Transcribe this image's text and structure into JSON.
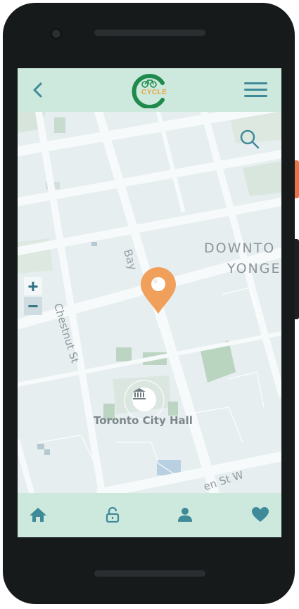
{
  "colors": {
    "accent": "#3f8a98",
    "header_bg": "#cde9dd",
    "pin": "#f0a05a",
    "logo_ring": "#1f8a4c",
    "logo_text": "#e8a53a"
  },
  "header": {
    "back_icon": "chevron-left-icon",
    "logo_text": "CYCLE",
    "menu_icon": "hamburger-icon"
  },
  "map": {
    "search_icon": "search-icon",
    "zoom_in_label": "+",
    "zoom_out_label": "−",
    "labels": {
      "downtown": "DOWNTO",
      "yonge": "YONGE",
      "bay": "Bay",
      "chestnut": "Chestnut St",
      "city_hall": "Toronto City Hall",
      "queen": "en St W"
    },
    "pin_icon": "map-pin-icon",
    "landmark_icon": "museum-icon"
  },
  "tabbar": {
    "tabs": [
      {
        "name": "home",
        "icon": "home-icon"
      },
      {
        "name": "unlock",
        "icon": "unlock-icon"
      },
      {
        "name": "profile",
        "icon": "user-icon"
      },
      {
        "name": "favorites",
        "icon": "heart-icon"
      }
    ]
  }
}
